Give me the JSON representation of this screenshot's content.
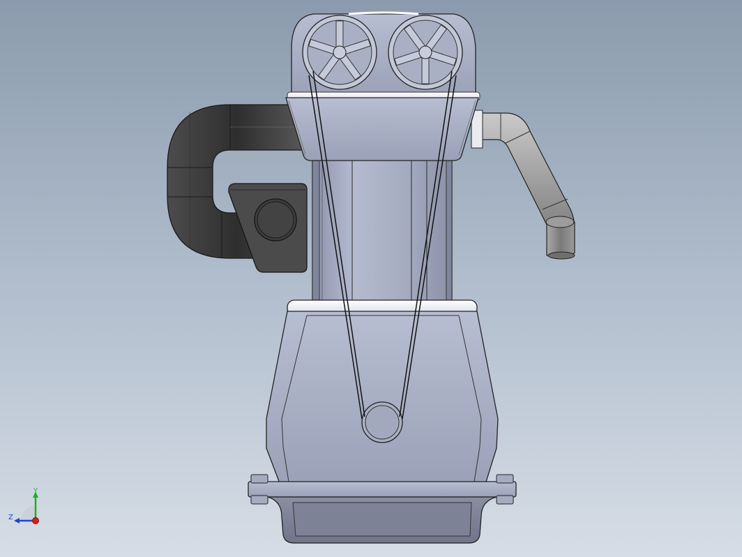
{
  "viewport": {
    "background_top": "#8b9bad",
    "background_bottom": "#d6dde6"
  },
  "model": {
    "body_color": "#a5acc1",
    "highlight_color": "#f4f6fb",
    "dark_part_color": "#4a4a4a",
    "pipe_color": "#8e8e8e",
    "edge_color": "#1e1e1e"
  },
  "triad": {
    "y_label": "Y",
    "z_label": "Z",
    "x_axis_color": "#d21e1e",
    "y_axis_color": "#1cb21c",
    "z_axis_color": "#1e44c8"
  }
}
